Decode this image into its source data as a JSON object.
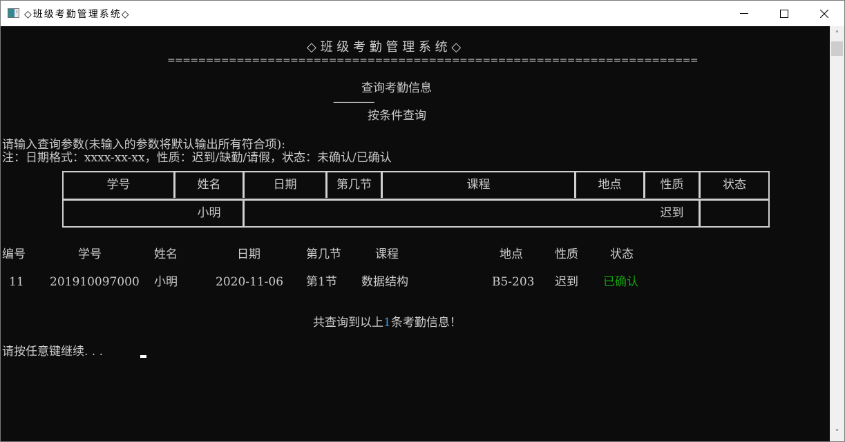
{
  "window": {
    "title": "◇班级考勤管理系统◇",
    "controls": {
      "minimize": "minimize",
      "maximize": "maximize",
      "close": "close"
    }
  },
  "console": {
    "banner": "◇ 班 级 考 勤 管 理 系 统 ◇",
    "banner_rule": "=====================================================================",
    "section_title": "查询考勤信息",
    "section_rule": "--------------------",
    "subsection_title": "按条件查询",
    "prompt_line": "请输入查询参数(未输入的参数将默认输出所有符合项):",
    "note_line": "注：日期格式：xxxx-xx-xx，性质：迟到/缺勤/请假，状态：未确认/已确认",
    "query_form": {
      "headers": [
        "学号",
        "姓名",
        "日期",
        "第几节",
        "课程",
        "地点",
        "性质",
        "状态"
      ],
      "values": [
        "",
        "小明",
        "",
        "",
        "",
        "",
        "迟到",
        ""
      ]
    },
    "results": {
      "headers": [
        "编号",
        "学号",
        "姓名",
        "日期",
        "第几节",
        "课程",
        "地点",
        "性质",
        "状态"
      ],
      "rows": [
        [
          "11",
          "201910097000",
          "小明",
          "2020-11-06",
          "第1节",
          "数据结构",
          "B5-203",
          "迟到",
          "已确认"
        ]
      ]
    },
    "summary": {
      "prefix": "共查询到以上",
      "count": "1",
      "suffix": "条考勤信息！"
    },
    "continue_prompt": "请按任意键继续. . ."
  },
  "colors": {
    "confirmed_status": "#13a10e",
    "count_highlight": "#3a96dd",
    "console_bg": "#0c0c0c",
    "console_fg": "#cccccc"
  }
}
